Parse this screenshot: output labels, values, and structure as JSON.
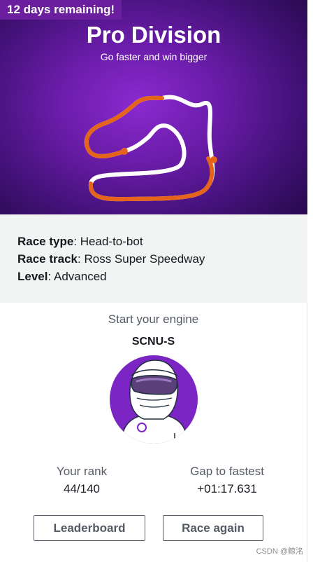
{
  "hero": {
    "badge": "12 days remaining!",
    "title": "Pro Division",
    "subtitle": "Go faster and win bigger",
    "colors": {
      "accent_orange": "#e4641c",
      "track_white": "#ffffff",
      "badge_bg": "#6b1f9e"
    }
  },
  "info": {
    "race_type_label": "Race type",
    "race_type_value": ": Head-to-bot",
    "race_track_label": "Race track",
    "race_track_value": ": Ross Super Speedway",
    "level_label": "Level",
    "level_value": ": Advanced"
  },
  "engine": {
    "heading": "Start your engine",
    "racer_name": "SCNU-S"
  },
  "avatar": {
    "icon": "racer-helmet-icon",
    "bg_color": "#7b26c4"
  },
  "stats": {
    "rank_label": "Your rank",
    "rank_value": "44/140",
    "gap_label": "Gap to fastest",
    "gap_value": "+01:17.631"
  },
  "buttons": {
    "leaderboard": "Leaderboard",
    "race_again": "Race again"
  },
  "footer": {
    "watermark": "CSDN @鲸洺"
  }
}
